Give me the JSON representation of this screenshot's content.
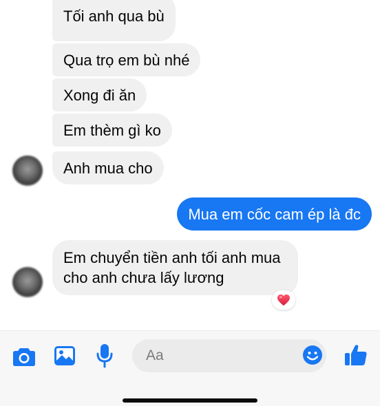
{
  "messages": {
    "incoming": [
      "Tối anh qua bù",
      "Qua trọ em bù nhé",
      "Xong đi ăn",
      "Em thèm gì ko",
      "Anh mua cho"
    ],
    "outgoing": "Mua em cốc cam ép là đc",
    "incoming_last": "Em chuyển tiền anh tối anh mua cho anh chưa lấy lương",
    "reaction": "❤️"
  },
  "composer": {
    "placeholder": "Aa",
    "icons": [
      "camera-icon",
      "image-icon",
      "mic-icon",
      "emoji-icon",
      "like-icon"
    ]
  },
  "colors": {
    "outgoing_bubble": "#1877f2",
    "incoming_bubble": "#f0f0f0",
    "accent_icons": "#1877f2"
  }
}
